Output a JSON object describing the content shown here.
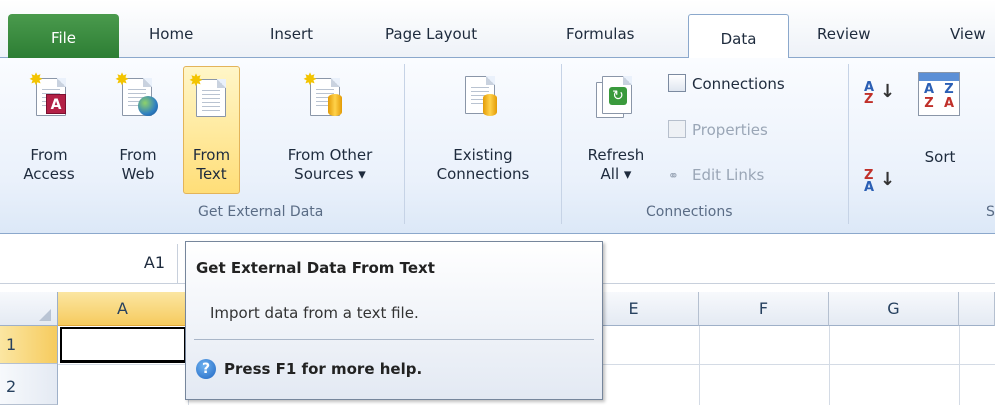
{
  "tabs": {
    "file": "File",
    "home": "Home",
    "insert": "Insert",
    "page_layout": "Page Layout",
    "formulas": "Formulas",
    "data": "Data",
    "review": "Review",
    "view": "View"
  },
  "ribbon": {
    "get_external": {
      "label": "Get External Data",
      "from_access": [
        "From",
        "Access"
      ],
      "from_web": [
        "From",
        "Web"
      ],
      "from_text": [
        "From",
        "Text"
      ],
      "from_other": [
        "From Other",
        "Sources ▾"
      ],
      "existing": [
        "Existing",
        "Connections"
      ]
    },
    "connections": {
      "label": "Connections",
      "refresh": [
        "Refresh",
        "All ▾"
      ],
      "connections_btn": "Connections",
      "properties": "Properties",
      "edit_links": "Edit Links"
    },
    "sort": {
      "sort_label": "Sort",
      "az_icon_text": "A↓Z",
      "za_icon_text": "Z↓A",
      "group_label_partial": "S"
    }
  },
  "formula_bar": {
    "name_box": "A1"
  },
  "grid": {
    "columns": [
      "A",
      "E",
      "F",
      "G"
    ],
    "rows": [
      "1",
      "2"
    ]
  },
  "tooltip": {
    "title": "Get External Data From Text",
    "description": "Import data from a text file.",
    "help": "Press F1 for more help."
  },
  "colors": {
    "file_tab": "#2d7e34",
    "active_button": "#ffde78",
    "selected_header": "#f6cb5e"
  }
}
